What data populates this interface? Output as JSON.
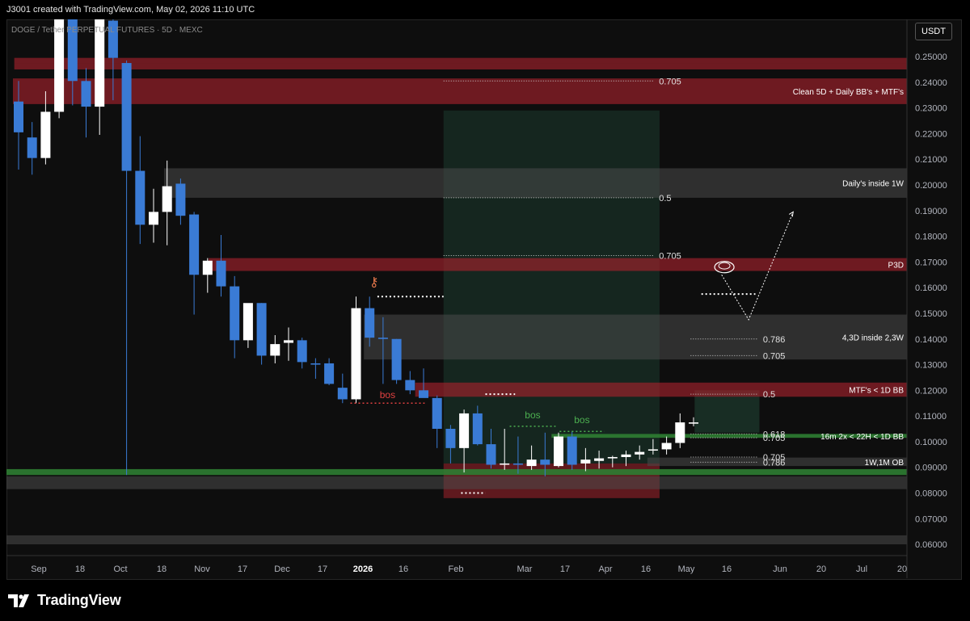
{
  "header": {
    "credit": "J3001 created with TradingView.com, May 02, 2026 11:10 UTC"
  },
  "symbol_line": "DOGE / Tether PERPETUAL FUTURES · 5D · MEXC",
  "currency_label": "USDT",
  "footer": {
    "brand": "TradingView"
  },
  "colors": {
    "up": "#ffffff",
    "down": "#3a7bd5",
    "zone_red": "#b02a35",
    "zone_green": "#2e7d32",
    "zone_gray": "#555555"
  },
  "chart_data": {
    "type": "candlestick",
    "ylim": [
      0.0575,
      0.2645
    ],
    "y_ticks": [
      "0.25000",
      "0.24000",
      "0.23000",
      "0.22000",
      "0.21000",
      "0.20000",
      "0.19000",
      "0.18000",
      "0.17000",
      "0.16000",
      "0.15000",
      "0.14000",
      "0.13000",
      "0.12000",
      "0.11000",
      "0.10000",
      "0.09000",
      "0.08000",
      "0.07000",
      "0.06000"
    ],
    "x_labels": [
      "Sep",
      "18",
      "Oct",
      "18",
      "Nov",
      "17",
      "Dec",
      "17",
      "2026",
      "16",
      "Feb",
      "Mar",
      "17",
      "Apr",
      "16",
      "May",
      "16",
      "Jun",
      "20",
      "Jul",
      "20"
    ],
    "candles": [
      [
        0.2325,
        0.2405,
        0.206,
        0.2205
      ],
      [
        0.2185,
        0.2245,
        0.204,
        0.2105
      ],
      [
        0.2105,
        0.2365,
        0.208,
        0.2285
      ],
      [
        0.2285,
        0.2655,
        0.226,
        0.2655
      ],
      [
        0.2645,
        0.2655,
        0.231,
        0.2405
      ],
      [
        0.2405,
        0.2455,
        0.2185,
        0.2305
      ],
      [
        0.2305,
        0.2655,
        0.2195,
        0.2655
      ],
      [
        0.264,
        0.2655,
        0.233,
        0.2495
      ],
      [
        0.2475,
        0.2485,
        0.087,
        0.2055
      ],
      [
        0.2055,
        0.219,
        0.177,
        0.1845
      ],
      [
        0.1845,
        0.1985,
        0.1775,
        0.1895
      ],
      [
        0.1895,
        0.2095,
        0.1765,
        0.1995
      ],
      [
        0.2005,
        0.2025,
        0.1845,
        0.188
      ],
      [
        0.1885,
        0.1895,
        0.1495,
        0.165
      ],
      [
        0.165,
        0.1715,
        0.158,
        0.1705
      ],
      [
        0.1705,
        0.1805,
        0.1565,
        0.1605
      ],
      [
        0.1605,
        0.1645,
        0.1325,
        0.1395
      ],
      [
        0.1395,
        0.153,
        0.1365,
        0.154
      ],
      [
        0.154,
        0.154,
        0.13,
        0.1335
      ],
      [
        0.1335,
        0.1415,
        0.1305,
        0.138
      ],
      [
        0.1385,
        0.1445,
        0.1315,
        0.1395
      ],
      [
        0.1395,
        0.1405,
        0.1285,
        0.131
      ],
      [
        0.1305,
        0.1325,
        0.1245,
        0.13
      ],
      [
        0.1305,
        0.1325,
        0.122,
        0.1225
      ],
      [
        0.121,
        0.1265,
        0.115,
        0.1165
      ],
      [
        0.1165,
        0.1565,
        0.115,
        0.152
      ],
      [
        0.152,
        0.1565,
        0.137,
        0.1405
      ],
      [
        0.1405,
        0.1485,
        0.1225,
        0.14
      ],
      [
        0.14,
        0.14,
        0.1225,
        0.124
      ],
      [
        0.124,
        0.1275,
        0.1185,
        0.12
      ],
      [
        0.12,
        0.1285,
        0.1175,
        0.117
      ],
      [
        0.117,
        0.118,
        0.0975,
        0.105
      ],
      [
        0.105,
        0.1065,
        0.0915,
        0.0975
      ],
      [
        0.0975,
        0.1125,
        0.088,
        0.111
      ],
      [
        0.111,
        0.114,
        0.0985,
        0.099
      ],
      [
        0.099,
        0.105,
        0.0895,
        0.091
      ],
      [
        0.091,
        0.105,
        0.089,
        0.0915
      ],
      [
        0.0915,
        0.102,
        0.0875,
        0.091
      ],
      [
        0.0905,
        0.0985,
        0.089,
        0.093
      ],
      [
        0.093,
        0.1035,
        0.0865,
        0.091
      ],
      [
        0.0905,
        0.1035,
        0.09,
        0.102
      ],
      [
        0.102,
        0.104,
        0.089,
        0.091
      ],
      [
        0.0915,
        0.0975,
        0.0885,
        0.093
      ],
      [
        0.0925,
        0.0965,
        0.0895,
        0.0935
      ],
      [
        0.0935,
        0.0945,
        0.09,
        0.094
      ],
      [
        0.094,
        0.0965,
        0.0905,
        0.095
      ],
      [
        0.095,
        0.0985,
        0.093,
        0.096
      ],
      [
        0.0965,
        0.101,
        0.095,
        0.097
      ],
      [
        0.097,
        0.102,
        0.095,
        0.0995
      ],
      [
        0.0995,
        0.111,
        0.0975,
        0.1075
      ],
      [
        0.107,
        0.1095,
        0.106,
        0.1075
      ]
    ],
    "zones": [
      {
        "color": "red",
        "y0": 0.2475,
        "y1": 0.2495,
        "start": 0.1,
        "end": "edge"
      },
      {
        "color": "red",
        "y0": 0.245,
        "y1": 0.2475,
        "start": 0.1,
        "end": "edge"
      },
      {
        "color": "red",
        "y0": 0.2315,
        "y1": 0.2415,
        "start": 0.0,
        "end": "edge",
        "label": "Clean 5D + Daily BB's + MTF's"
      },
      {
        "color": "gray",
        "y0": 0.195,
        "y1": 0.2065,
        "start": 11.2,
        "end": "edge",
        "label": "Daily's inside 1W"
      },
      {
        "color": "red",
        "y0": 0.1665,
        "y1": 0.1715,
        "start": 14.5,
        "end": "edge",
        "label": "P3D"
      },
      {
        "color": "gray",
        "y0": 0.132,
        "y1": 0.1495,
        "start": 26.0,
        "end": "edge",
        "label": "4,3D inside 2,3W"
      },
      {
        "color": "red",
        "y0": 0.1175,
        "y1": 0.123,
        "start": 29.8,
        "end": "edge",
        "label": "MTF's < 1D BB"
      },
      {
        "color": "green",
        "y0": 0.1015,
        "y1": 0.103,
        "start": 39.9,
        "end": "edge",
        "label": "16m 2x < 22H < 1D BB"
      },
      {
        "color": "gray",
        "y0": 0.0905,
        "y1": 0.0938,
        "start": 47.0,
        "end": "edge",
        "label": "1W,1M OB"
      },
      {
        "color": "green",
        "y0": 0.087,
        "y1": 0.0893,
        "start": "edge-left",
        "end": "edge"
      },
      {
        "color": "gray",
        "y0": 0.0815,
        "y1": 0.0865,
        "start": "edge-left",
        "end": "edge"
      },
      {
        "color": "gray",
        "y0": 0.06,
        "y1": 0.0635,
        "start": "edge-left",
        "end": "edge"
      }
    ],
    "position": {
      "start": 31.9,
      "end": 47.9,
      "entry": 0.0915,
      "target": 0.229,
      "stop": 0.078
    },
    "box2": {
      "start": 50.5,
      "end": 55.3,
      "top": 0.12,
      "bottom": 0.1035
    },
    "fib_levels": [
      {
        "text": "0.705",
        "value": 0.2405,
        "x0": 31.9,
        "x1": 47.5
      },
      {
        "text": "0.5",
        "value": 0.195,
        "x0": 31.9,
        "x1": 47.5
      },
      {
        "text": "0.705",
        "value": 0.1725,
        "x0": 31.9,
        "x1": 47.5
      },
      {
        "text": "0.786",
        "value": 0.14,
        "x0": 50.2,
        "x1": 55.2
      },
      {
        "text": "0.705",
        "value": 0.1335,
        "x0": 50.2,
        "x1": 55.2
      },
      {
        "text": "0.5",
        "value": 0.1185,
        "x0": 50.2,
        "x1": 55.2
      },
      {
        "text": "0.618",
        "value": 0.103,
        "x0": 50.2,
        "x1": 55.2
      },
      {
        "text": "0.705",
        "value": 0.1015,
        "x0": 50.2,
        "x1": 55.2
      },
      {
        "text": "0.705",
        "value": 0.094,
        "x0": 50.2,
        "x1": 55.2
      },
      {
        "text": "0.786",
        "value": 0.092,
        "x0": 50.2,
        "x1": 55.2
      }
    ],
    "bos": [
      {
        "text": "bos",
        "color": "#e04040",
        "value": 0.115,
        "x0": 25.0,
        "x1": 30.5,
        "label_below": true
      },
      {
        "text": "bos",
        "color": "#4caf50",
        "value": 0.106,
        "x0": 36.8,
        "x1": 40.2,
        "label_below": false
      },
      {
        "text": "bos",
        "color": "#4caf50",
        "value": 0.104,
        "x0": 40.5,
        "x1": 43.8,
        "label_below": false
      }
    ],
    "swing_marks": [
      {
        "value": 0.1565,
        "x0": 27.0,
        "x1": 31.9
      },
      {
        "value": 0.1185,
        "x0": 35.0,
        "x1": 37.2
      },
      {
        "value": 0.08,
        "x0": 33.2,
        "x1": 35.0
      },
      {
        "value": 0.1575,
        "x0": 51.0,
        "x1": 55.0
      }
    ],
    "projection": [
      [
        52.5,
        0.165
      ],
      [
        54.5,
        0.1475
      ],
      [
        57.8,
        0.1895
      ]
    ]
  }
}
